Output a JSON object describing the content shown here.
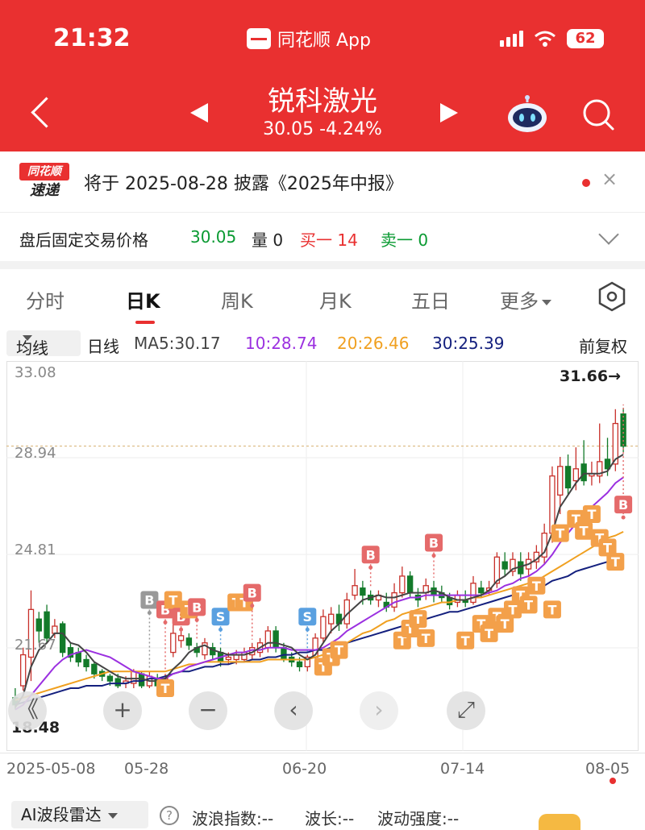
{
  "status": {
    "time": "21:32",
    "app": "同花顺 App",
    "battery": "62"
  },
  "header": {
    "stock_name": "锐科激光",
    "quote": "30.05  -4.24%"
  },
  "notice": {
    "logo_top": "同花顺",
    "logo_bottom": "速递",
    "text": "将于 2025-08-28 披露《2025年中报》",
    "close": "×"
  },
  "after_hours": {
    "label": "盘后固定交易价格",
    "price": "30.05",
    "volume": "量 0",
    "buy1": "买一 14",
    "sell1": "卖一 0"
  },
  "tabs": [
    "分时",
    "日K",
    "周K",
    "月K",
    "五日",
    "更多"
  ],
  "ma": {
    "select": "均线",
    "period": "日线",
    "ma5": "MA5:30.17",
    "ma10": "10:28.74",
    "ma20": "20:26.46",
    "ma30": "30:25.39",
    "adjust": "前复权",
    "colors": {
      "ma5": "#444444",
      "ma10": "#9b30e0",
      "ma20": "#f0a020",
      "ma30": "#14207e"
    }
  },
  "chart_data": {
    "type": "candlestick",
    "yticks": [
      "33.08",
      "28.94",
      "24.81",
      "21.67",
      "18.48"
    ],
    "high_label": "31.66→",
    "low_label": "18.48",
    "current_price": 30.05,
    "ylim": [
      18.48,
      33.08
    ],
    "xticks": [
      "2025-05-08",
      "05-28",
      "06-20",
      "07-14",
      "08-05"
    ],
    "colors": {
      "up": "#c8302a",
      "down": "#137a2a",
      "B": "#e56a6a",
      "S": "#5aa0e0",
      "T": "#f3a04a",
      "grey": "#999999"
    },
    "candles": [
      [
        19.5,
        19.2,
        19.9,
        19.0
      ],
      [
        20.0,
        21.3,
        21.6,
        19.8
      ],
      [
        21.2,
        23.2,
        24.0,
        20.2
      ],
      [
        22.8,
        22.3,
        23.1,
        21.8
      ],
      [
        23.1,
        22.0,
        23.4,
        21.8
      ],
      [
        22.2,
        22.5,
        22.8,
        22.0
      ],
      [
        22.6,
        21.4,
        22.7,
        21.2
      ],
      [
        21.6,
        21.2,
        21.8,
        21.0
      ],
      [
        21.4,
        21.0,
        21.6,
        20.8
      ],
      [
        21.1,
        20.8,
        21.3,
        20.6
      ],
      [
        20.9,
        20.5,
        21.0,
        20.3
      ],
      [
        20.6,
        20.4,
        20.7,
        20.2
      ],
      [
        20.4,
        20.2,
        20.5,
        20.0
      ],
      [
        20.3,
        20.0,
        20.5,
        19.9
      ],
      [
        20.1,
        20.2,
        20.4,
        19.9
      ],
      [
        20.1,
        20.6,
        20.7,
        19.9
      ],
      [
        20.5,
        20.0,
        20.6,
        19.9
      ],
      [
        20.0,
        20.4,
        20.6,
        19.9
      ],
      [
        20.3,
        20.0,
        20.5,
        19.9
      ],
      [
        20.1,
        20.3,
        20.5,
        20.0
      ],
      [
        21.4,
        22.2,
        22.6,
        21.2
      ],
      [
        21.9,
        22.1,
        22.3,
        21.6
      ],
      [
        22.0,
        21.7,
        22.2,
        21.5
      ],
      [
        21.6,
        21.4,
        21.8,
        21.2
      ],
      [
        21.3,
        21.8,
        22.0,
        21.1
      ],
      [
        21.6,
        21.3,
        21.8,
        21.1
      ],
      [
        21.4,
        21.0,
        21.6,
        20.8
      ],
      [
        21.1,
        21.2,
        21.4,
        20.9
      ],
      [
        21.1,
        21.3,
        21.5,
        20.9
      ],
      [
        21.1,
        21.4,
        21.6,
        21.0
      ],
      [
        21.3,
        21.6,
        21.8,
        21.1
      ],
      [
        21.4,
        21.8,
        22.0,
        21.2
      ],
      [
        21.6,
        22.3,
        22.5,
        21.4
      ],
      [
        22.3,
        21.6,
        22.5,
        21.4
      ],
      [
        21.6,
        21.1,
        21.8,
        21.0
      ],
      [
        21.2,
        21.0,
        21.4,
        20.8
      ],
      [
        21.0,
        20.8,
        21.2,
        20.6
      ],
      [
        20.8,
        21.2,
        21.3,
        20.6
      ],
      [
        21.2,
        22.0,
        22.2,
        21.0
      ],
      [
        22.0,
        22.9,
        23.2,
        21.8
      ],
      [
        22.6,
        23.0,
        23.3,
        22.2
      ],
      [
        23.0,
        22.6,
        23.4,
        22.3
      ],
      [
        22.6,
        23.6,
        23.9,
        22.4
      ],
      [
        23.8,
        24.2,
        24.9,
        23.6
      ],
      [
        24.1,
        23.8,
        24.4,
        23.4
      ],
      [
        23.8,
        23.6,
        24.0,
        23.4
      ],
      [
        23.6,
        23.8,
        24.0,
        23.3
      ],
      [
        23.5,
        23.3,
        23.9,
        23.1
      ],
      [
        23.3,
        23.9,
        24.3,
        23.1
      ],
      [
        23.9,
        24.6,
        25.0,
        23.7
      ],
      [
        24.6,
        23.9,
        24.8,
        23.7
      ],
      [
        23.8,
        23.6,
        24.1,
        23.3
      ],
      [
        23.9,
        24.2,
        24.5,
        23.6
      ],
      [
        24.1,
        23.8,
        24.4,
        23.5
      ],
      [
        23.9,
        23.7,
        24.2,
        23.5
      ],
      [
        23.7,
        23.4,
        23.9,
        23.2
      ],
      [
        23.5,
        23.8,
        24.0,
        23.3
      ],
      [
        23.6,
        23.5,
        24.0,
        23.3
      ],
      [
        23.5,
        24.3,
        24.6,
        23.4
      ],
      [
        24.1,
        23.9,
        24.4,
        23.7
      ],
      [
        24.0,
        24.1,
        24.4,
        23.8
      ],
      [
        24.3,
        25.4,
        25.6,
        24.1
      ],
      [
        25.2,
        24.9,
        25.6,
        24.6
      ],
      [
        24.8,
        25.3,
        25.6,
        24.6
      ],
      [
        25.2,
        24.7,
        25.6,
        24.4
      ],
      [
        24.9,
        25.3,
        25.6,
        24.6
      ],
      [
        25.2,
        25.6,
        25.9,
        24.9
      ],
      [
        25.4,
        26.4,
        26.8,
        25.1
      ],
      [
        26.4,
        28.8,
        29.2,
        26.0
      ],
      [
        28.0,
        29.2,
        29.6,
        27.2
      ],
      [
        29.2,
        28.3,
        29.7,
        28.0
      ],
      [
        28.6,
        29.1,
        30.0,
        28.2
      ],
      [
        29.3,
        28.6,
        30.3,
        28.4
      ],
      [
        28.8,
        28.9,
        29.4,
        28.4
      ],
      [
        28.8,
        29.4,
        31.0,
        28.5
      ],
      [
        29.5,
        29.1,
        30.4,
        28.8
      ],
      [
        29.3,
        31.0,
        31.6,
        29.0
      ],
      [
        31.4,
        30.05,
        31.66,
        29.8
      ]
    ],
    "ma5": [
      19.1,
      19.6,
      20.8,
      21.5,
      21.8,
      22.2,
      22.2,
      21.8,
      21.7,
      21.4,
      21.0,
      20.8,
      20.6,
      20.4,
      20.3,
      20.3,
      20.3,
      20.2,
      20.2,
      20.3,
      20.7,
      21.0,
      21.4,
      21.6,
      21.7,
      21.5,
      21.4,
      21.3,
      21.3,
      21.3,
      21.4,
      21.6,
      21.8,
      21.8,
      21.7,
      21.6,
      21.3,
      21.1,
      21.3,
      21.8,
      22.3,
      22.6,
      23.0,
      23.3,
      23.6,
      23.7,
      23.8,
      23.7,
      23.7,
      23.8,
      23.9,
      23.9,
      23.9,
      24.0,
      23.9,
      23.7,
      23.6,
      23.6,
      23.7,
      23.8,
      24.0,
      24.4,
      24.6,
      24.9,
      25.0,
      25.1,
      25.3,
      25.6,
      26.4,
      27.5,
      28.0,
      28.5,
      28.9,
      28.9,
      28.9,
      29.0,
      29.5,
      29.7
    ],
    "ma10": [
      19.0,
      19.2,
      19.6,
      20.0,
      20.4,
      20.8,
      21.1,
      21.3,
      21.4,
      21.5,
      21.4,
      21.3,
      21.2,
      21.0,
      20.8,
      20.6,
      20.5,
      20.4,
      20.3,
      20.3,
      20.5,
      20.6,
      20.8,
      20.9,
      21.0,
      21.1,
      21.2,
      21.3,
      21.4,
      21.4,
      21.5,
      21.5,
      21.6,
      21.6,
      21.6,
      21.5,
      21.5,
      21.5,
      21.5,
      21.6,
      21.8,
      22.0,
      22.3,
      22.5,
      22.7,
      22.9,
      23.1,
      23.3,
      23.5,
      23.6,
      23.7,
      23.7,
      23.8,
      23.8,
      23.8,
      23.8,
      23.8,
      23.8,
      23.8,
      23.8,
      23.9,
      24.0,
      24.2,
      24.3,
      24.5,
      24.6,
      24.8,
      25.1,
      25.5,
      26.0,
      26.4,
      26.8,
      27.2,
      27.5,
      27.8,
      28.1,
      28.5,
      28.74
    ],
    "ma20": [
      19.4,
      19.5,
      19.6,
      19.7,
      19.8,
      19.9,
      20.0,
      20.1,
      20.2,
      20.3,
      20.4,
      20.5,
      20.6,
      20.6,
      20.6,
      20.6,
      20.6,
      20.6,
      20.6,
      20.6,
      20.7,
      20.8,
      20.9,
      20.9,
      21.0,
      21.0,
      21.0,
      21.0,
      21.0,
      21.0,
      21.0,
      21.0,
      21.1,
      21.1,
      21.1,
      21.1,
      21.1,
      21.1,
      21.2,
      21.3,
      21.5,
      21.6,
      21.8,
      22.0,
      22.2,
      22.3,
      22.5,
      22.7,
      22.8,
      23.0,
      23.1,
      23.2,
      23.3,
      23.4,
      23.5,
      23.5,
      23.6,
      23.6,
      23.7,
      23.7,
      23.8,
      23.9,
      24.0,
      24.1,
      24.2,
      24.3,
      24.4,
      24.6,
      24.8,
      25.0,
      25.2,
      25.4,
      25.6,
      25.8,
      26.0,
      26.2,
      26.3,
      26.46
    ],
    "ma30": [
      19.2,
      19.3,
      19.4,
      19.5,
      19.6,
      19.7,
      19.8,
      19.9,
      19.9,
      20.0,
      20.0,
      20.0,
      20.1,
      20.1,
      20.1,
      20.2,
      20.2,
      20.3,
      20.3,
      20.4,
      20.5,
      20.6,
      20.6,
      20.7,
      20.8,
      20.8,
      20.9,
      20.9,
      21.0,
      21.0,
      21.1,
      21.1,
      21.2,
      21.2,
      21.3,
      21.3,
      21.4,
      21.4,
      21.5,
      21.5,
      21.6,
      21.7,
      21.8,
      21.9,
      22.0,
      22.1,
      22.2,
      22.3,
      22.4,
      22.5,
      22.6,
      22.7,
      22.8,
      22.9,
      23.0,
      23.1,
      23.1,
      23.2,
      23.3,
      23.4,
      23.5,
      23.6,
      23.7,
      23.8,
      23.9,
      24.0,
      24.1,
      24.2,
      24.4,
      24.5,
      24.6,
      24.8,
      24.9,
      25.0,
      25.1,
      25.2,
      25.3,
      25.39
    ],
    "markers": [
      {
        "i": 17,
        "t": "B",
        "color": "grey",
        "price": 23.6
      },
      {
        "i": 19,
        "t": "B",
        "color": "B",
        "price": 23.2
      },
      {
        "i": 20,
        "t": "T",
        "color": "T",
        "price": 23.6
      },
      {
        "i": 21,
        "t": "B",
        "color": "B",
        "price": 22.9
      },
      {
        "i": 22,
        "t": "T",
        "color": "T",
        "price": 23.2
      },
      {
        "i": 23,
        "t": "B",
        "color": "B",
        "price": 23.3
      },
      {
        "i": 26,
        "t": "S",
        "color": "S",
        "price": 22.9
      },
      {
        "i": 28,
        "t": "T",
        "color": "T",
        "price": 23.5
      },
      {
        "i": 29,
        "t": "T",
        "color": "T",
        "price": 23.5
      },
      {
        "i": 30,
        "t": "B",
        "color": "B",
        "price": 23.9
      },
      {
        "i": 37,
        "t": "S",
        "color": "S",
        "price": 22.9
      },
      {
        "i": 45,
        "t": "B",
        "color": "B",
        "price": 25.5
      },
      {
        "i": 53,
        "t": "B",
        "color": "B",
        "price": 26.0
      },
      {
        "i": 19,
        "t": "T",
        "color": "T",
        "price": 19.9
      },
      {
        "i": 39,
        "t": "T",
        "color": "T",
        "price": 20.8
      },
      {
        "i": 40,
        "t": "T",
        "color": "T",
        "price": 21.2
      },
      {
        "i": 41,
        "t": "T",
        "color": "T",
        "price": 21.5
      },
      {
        "i": 49,
        "t": "T",
        "color": "T",
        "price": 21.9
      },
      {
        "i": 50,
        "t": "T",
        "color": "T",
        "price": 22.4
      },
      {
        "i": 51,
        "t": "T",
        "color": "T",
        "price": 22.8
      },
      {
        "i": 52,
        "t": "T",
        "color": "T",
        "price": 22.0
      },
      {
        "i": 57,
        "t": "T",
        "color": "T",
        "price": 21.9
      },
      {
        "i": 59,
        "t": "T",
        "color": "T",
        "price": 22.6
      },
      {
        "i": 60,
        "t": "T",
        "color": "T",
        "price": 22.2
      },
      {
        "i": 61,
        "t": "T",
        "color": "T",
        "price": 22.9
      },
      {
        "i": 62,
        "t": "T",
        "color": "T",
        "price": 22.6
      },
      {
        "i": 63,
        "t": "T",
        "color": "T",
        "price": 23.2
      },
      {
        "i": 64,
        "t": "T",
        "color": "T",
        "price": 23.8
      },
      {
        "i": 65,
        "t": "T",
        "color": "T",
        "price": 23.4
      },
      {
        "i": 66,
        "t": "T",
        "color": "T",
        "price": 24.2
      },
      {
        "i": 68,
        "t": "T",
        "color": "T",
        "price": 23.2
      },
      {
        "i": 69,
        "t": "T",
        "color": "T",
        "price": 26.4
      },
      {
        "i": 71,
        "t": "T",
        "color": "T",
        "price": 27.0
      },
      {
        "i": 72,
        "t": "T",
        "color": "T",
        "price": 26.5
      },
      {
        "i": 73,
        "t": "T",
        "color": "T",
        "price": 27.2
      },
      {
        "i": 74,
        "t": "T",
        "color": "T",
        "price": 26.2
      },
      {
        "i": 75,
        "t": "T",
        "color": "T",
        "price": 25.8
      },
      {
        "i": 76,
        "t": "T",
        "color": "T",
        "price": 25.2
      },
      {
        "i": 77,
        "t": "B",
        "color": "B",
        "price": 27.6
      }
    ]
  },
  "controls": {
    "zoom_out": "《",
    "plus": "+",
    "minus": "−",
    "left": "‹",
    "right": "›",
    "fit": "⤢"
  },
  "radar": {
    "select": "AI波段雷达",
    "help": "?",
    "wave_index": "波浪指数:--",
    "wavelength": "波长:--",
    "volatility": "波动强度:--"
  }
}
